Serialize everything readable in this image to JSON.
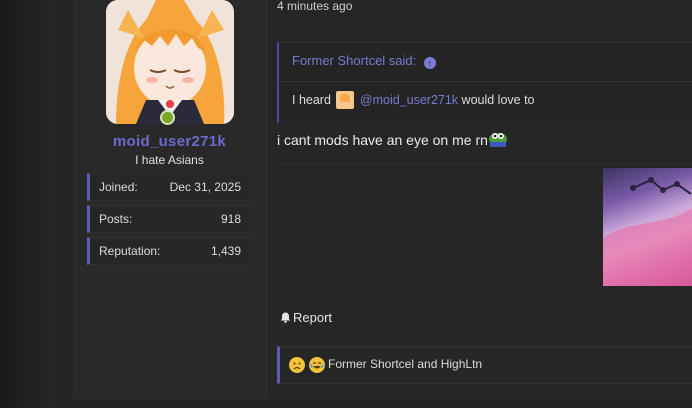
{
  "user": {
    "username": "moid_user271k",
    "title": "I hate Asians",
    "stats": [
      {
        "label": "Joined:",
        "value": "Dec 31, 2025"
      },
      {
        "label": "Posts:",
        "value": "918"
      },
      {
        "label": "Reputation:",
        "value": "1,439"
      }
    ]
  },
  "post": {
    "time": "4 minutes ago",
    "quote": {
      "author_line": "Former Shortcel said:",
      "text_prefix": "I heard",
      "mention": "@moid_user271k",
      "text_suffix": "would love to"
    },
    "message": "i cant mods have an eye on me rn",
    "report_label": "Report",
    "reactions_text": "Former Shortcel and HighLtn"
  },
  "colors": {
    "accent": "#6b6ad0",
    "online": "#7ba62b"
  }
}
